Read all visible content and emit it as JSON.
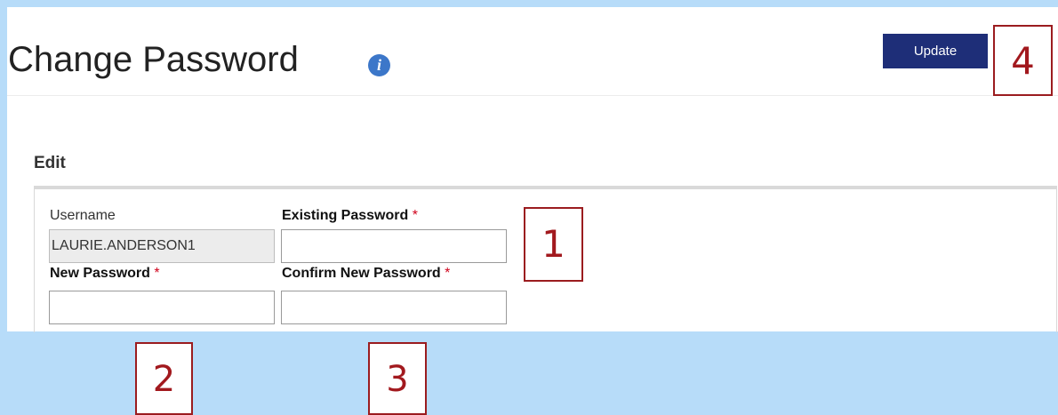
{
  "header": {
    "title": "Change Password",
    "info_icon_glyph": "i",
    "update_label": "Update"
  },
  "section": {
    "heading": "Edit"
  },
  "form": {
    "username_label": "Username",
    "username_value": "LAURIE.ANDERSON1",
    "existing_password_label": "Existing Password",
    "new_password_label": "New Password",
    "confirm_password_label": "Confirm New Password",
    "required_marker": "*",
    "existing_password_value": "",
    "new_password_value": "",
    "confirm_password_value": ""
  },
  "callouts": [
    "1",
    "2",
    "3",
    "4"
  ],
  "colors": {
    "background": "#b7dcf9",
    "update_button": "#1e2e78",
    "info_icon": "#3c77c9",
    "required": "#d0021b",
    "callout": "#9b1c1f"
  },
  "icons": {
    "info": "info-circle-icon"
  }
}
